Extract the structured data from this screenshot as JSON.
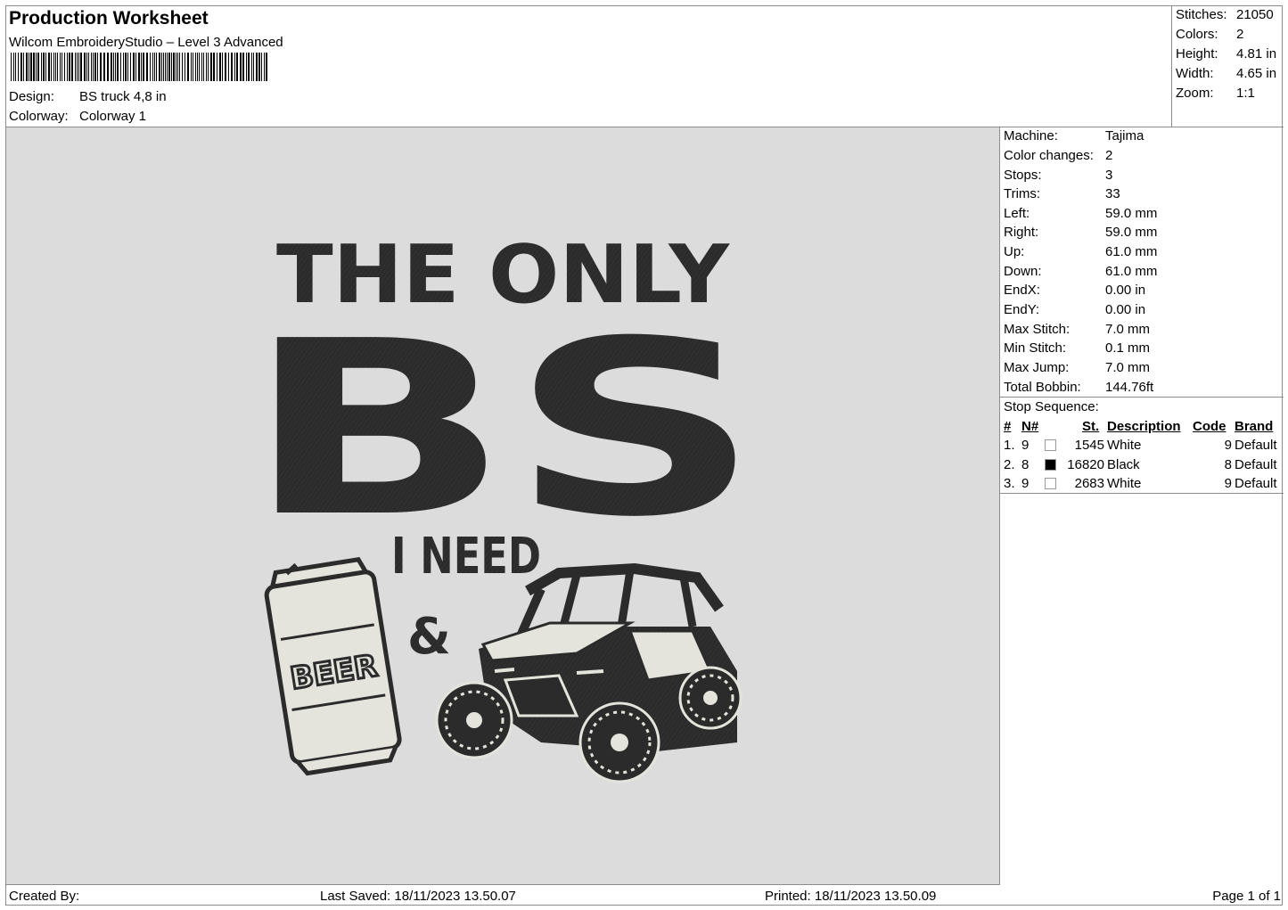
{
  "header": {
    "title": "Production Worksheet",
    "software": "Wilcom EmbroideryStudio – Level 3 Advanced",
    "design_label": "Design:",
    "design_value": "BS truck 4,8 in",
    "colorway_label": "Colorway:",
    "colorway_value": "Colorway 1"
  },
  "summary": [
    {
      "label": "Stitches:",
      "value": "21050"
    },
    {
      "label": "Colors:",
      "value": "2"
    },
    {
      "label": "Height:",
      "value": "4.81 in"
    },
    {
      "label": "Width:",
      "value": "4.65 in"
    },
    {
      "label": "Zoom:",
      "value": "1:1"
    }
  ],
  "machine_info": [
    {
      "label": "Machine:",
      "value": "Tajima"
    },
    {
      "label": "Color changes:",
      "value": "2"
    },
    {
      "label": "Stops:",
      "value": "3"
    },
    {
      "label": "Trims:",
      "value": "33"
    },
    {
      "label": "Left:",
      "value": "59.0 mm"
    },
    {
      "label": "Right:",
      "value": "59.0 mm"
    },
    {
      "label": "Up:",
      "value": "61.0 mm"
    },
    {
      "label": "Down:",
      "value": "61.0 mm"
    },
    {
      "label": "EndX:",
      "value": "0.00 in"
    },
    {
      "label": "EndY:",
      "value": "0.00 in"
    },
    {
      "label": "Max Stitch:",
      "value": "7.0 mm"
    },
    {
      "label": "Min Stitch:",
      "value": "0.1 mm"
    },
    {
      "label": "Max Jump:",
      "value": "7.0 mm"
    },
    {
      "label": "Total Bobbin:",
      "value": "144.76ft"
    }
  ],
  "stop_sequence": {
    "heading": "Stop Sequence:",
    "columns": [
      "#",
      "N#",
      "St.",
      "Description",
      "Code",
      "Brand"
    ],
    "rows": [
      {
        "num": "1.",
        "needle": "9",
        "color": "#ffffff",
        "stitches": "1545",
        "description": "White",
        "code": "9",
        "brand": "Default"
      },
      {
        "num": "2.",
        "needle": "8",
        "color": "#000000",
        "stitches": "16820",
        "description": "Black",
        "code": "8",
        "brand": "Default"
      },
      {
        "num": "3.",
        "needle": "9",
        "color": "#ffffff",
        "stitches": "2683",
        "description": "White",
        "code": "9",
        "brand": "Default"
      }
    ]
  },
  "design": {
    "line1": "THE ONLY",
    "line2": "BS",
    "line3": "I NEED",
    "ampersand": "&",
    "can_label": "BEER",
    "background_color": "#dcdcdc",
    "thread_black": "#2b2b2b",
    "thread_white": "#e4e4dc"
  },
  "footer": {
    "created_by": "Created By:",
    "last_saved": "Last Saved: 18/11/2023 13.50.07",
    "printed": "Printed: 18/11/2023 13.50.09",
    "page": "Page 1 of 1"
  }
}
